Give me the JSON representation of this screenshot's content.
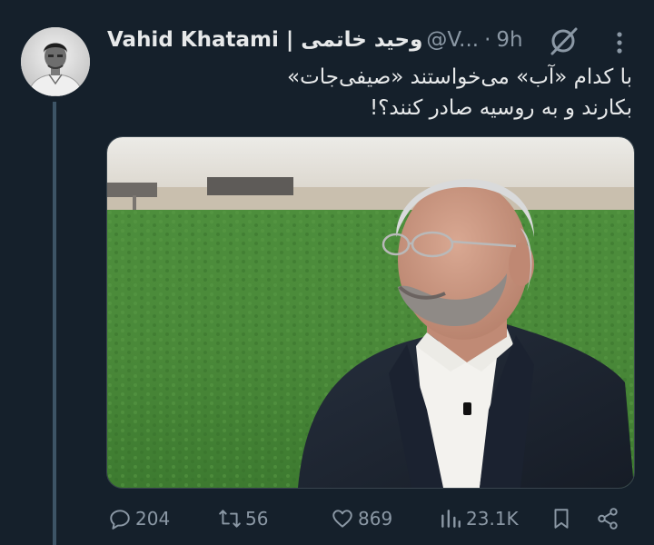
{
  "tweet": {
    "display_name": "Vahid Khatami | وحید خاتمی",
    "handle": "@V...",
    "separator": "·",
    "time": "9h",
    "text": "با کدام «آب» می‌خواستند «صیفی‌جات» بکارند و به روسیه صادر کنند؟!"
  },
  "stats": {
    "replies": "204",
    "retweets": "56",
    "likes": "869",
    "views": "23.1K"
  },
  "icons": [
    "grok-icon",
    "more-icon",
    "reply-icon",
    "retweet-icon",
    "like-icon",
    "views-icon",
    "bookmark-icon",
    "share-icon"
  ],
  "colors": {
    "background": "#15202b",
    "text": "#e7e9ea",
    "muted": "#8b98a5",
    "thread_line": "#3d5466"
  }
}
